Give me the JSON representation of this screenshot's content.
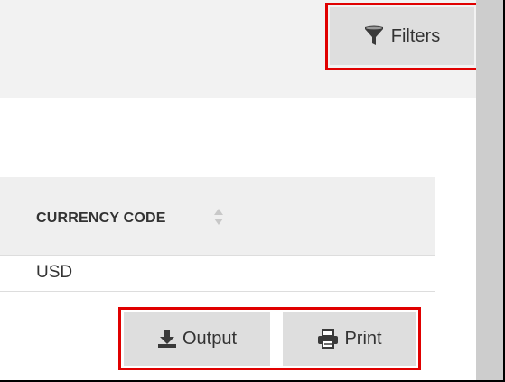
{
  "toolbar": {
    "filters_label": "Filters",
    "filters_icon": "filter-funnel-icon"
  },
  "table": {
    "columns": [
      {
        "label": "CURRENCY CODE",
        "sort_icon": "sort-both-icon"
      }
    ],
    "rows": [
      {
        "currency_code": "USD"
      }
    ]
  },
  "actions": {
    "output_label": "Output",
    "output_icon": "download-icon",
    "print_label": "Print",
    "print_icon": "printer-icon"
  },
  "colors": {
    "highlight": "#e00000",
    "button_bg": "#dedede",
    "header_bg": "#efefef",
    "scrollbar": "#cdcdcd"
  }
}
